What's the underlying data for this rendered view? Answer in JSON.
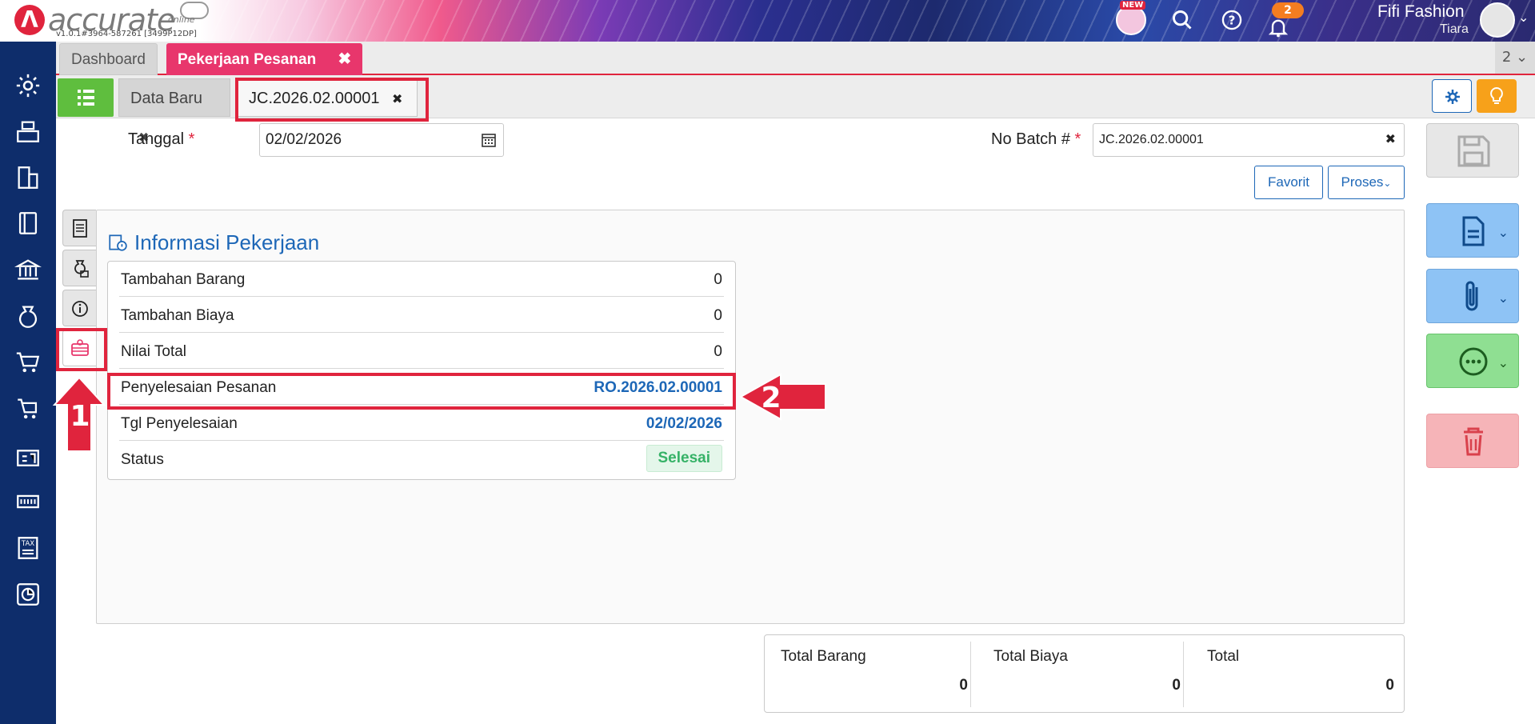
{
  "app": {
    "brand": "accurate",
    "brand_sub": "online",
    "version": "v1.0.1#3964-587261 [3499P12DP]",
    "new_badge": "NEW",
    "notification_count": "2",
    "user_name": "Fifi Fashion",
    "user_sub": "Tiara"
  },
  "tabs_top": {
    "dashboard": "Dashboard",
    "active": "Pekerjaan Pesanan",
    "count": "2"
  },
  "tabs_sub": {
    "new": "Data Baru",
    "current": "JC.2026.02.00001"
  },
  "form": {
    "date_label": "Tanggal",
    "date_value": "02/02/2026",
    "batch_label": "No Batch #",
    "batch_value": "JC.2026.02.00001",
    "favorit": "Favorit",
    "proses": "Proses"
  },
  "section": {
    "title": "Informasi Pekerjaan",
    "rows": [
      {
        "label": "Tambahan Barang",
        "value": "0"
      },
      {
        "label": "Tambahan Biaya",
        "value": "0"
      },
      {
        "label": "Nilai Total",
        "value": "0"
      },
      {
        "label": "Penyelesaian Pesanan",
        "value": "RO.2026.02.00001"
      },
      {
        "label": "Tgl Penyelesaian",
        "value": "02/02/2026"
      },
      {
        "label": "Status",
        "value": "Selesai"
      }
    ]
  },
  "annotations": {
    "step1": "1",
    "step2": "2",
    "color": "#e0243d"
  },
  "totals": {
    "barang_label": "Total Barang",
    "barang_value": "0",
    "biaya_label": "Total Biaya",
    "biaya_value": "0",
    "total_label": "Total",
    "total_value": "0"
  },
  "colors": {
    "sidebar": "#0e2d6b",
    "accent_pink": "#e8366c",
    "link_blue": "#1d67b7",
    "green": "#5fbe3e"
  }
}
